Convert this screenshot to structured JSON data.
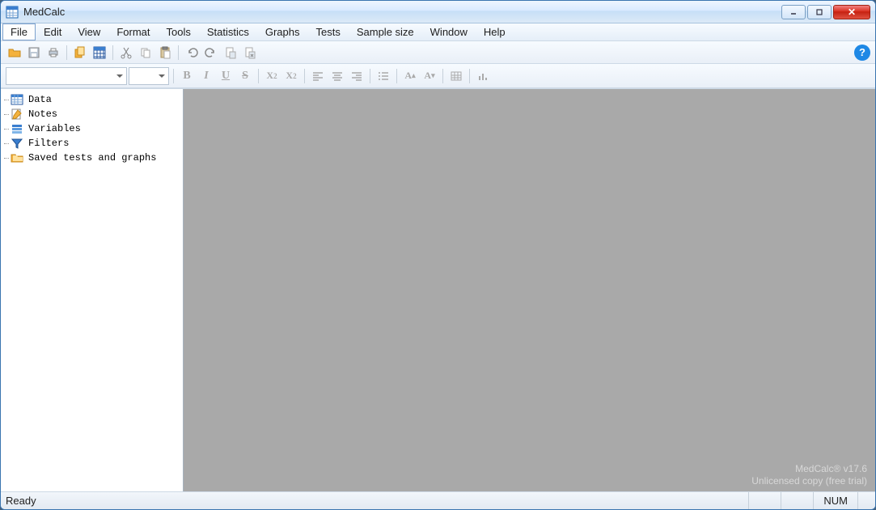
{
  "title": "MedCalc",
  "menus": [
    "File",
    "Edit",
    "View",
    "Format",
    "Tools",
    "Statistics",
    "Graphs",
    "Tests",
    "Sample size",
    "Window",
    "Help"
  ],
  "active_menu_index": 0,
  "sidebar": {
    "items": [
      {
        "label": "Data",
        "icon": "table-icon"
      },
      {
        "label": "Notes",
        "icon": "notes-icon"
      },
      {
        "label": "Variables",
        "icon": "variables-icon"
      },
      {
        "label": "Filters",
        "icon": "filter-icon"
      },
      {
        "label": "Saved tests and graphs",
        "icon": "folder-icon"
      }
    ]
  },
  "workspace": {
    "watermark_line1": "MedCalc® v17.6",
    "watermark_line2": "Unlicensed copy (free trial)"
  },
  "statusbar": {
    "status": "Ready",
    "indicator": "NUM"
  },
  "font_combo": "",
  "size_combo": ""
}
